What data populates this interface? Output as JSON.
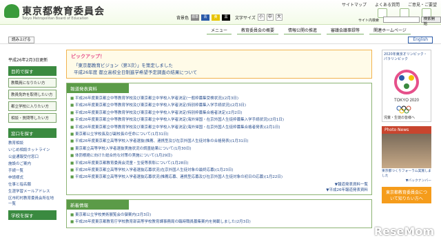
{
  "header": {
    "title": "東京都教育委員会",
    "subtitle": "Tokyo Metropolitan Board of Education",
    "links": [
      "サイトマップ",
      "よくある質問",
      "ご意見・ご要望"
    ],
    "bg_label": "背景色",
    "bg_options": [
      "標準",
      "青",
      "黄",
      "黒"
    ],
    "font_label": "文字サイズ",
    "font_options": [
      "小",
      "中",
      "大"
    ],
    "search_label": "サイト内検索",
    "search_button": "検索開始"
  },
  "nav": [
    "メニュー",
    "教育委員会の概要",
    "情報公開の推進",
    "審議会議事録等",
    "関連ホームページ"
  ],
  "subbar": {
    "read_button": "読み上げる",
    "english": "English"
  },
  "left": {
    "date": "平成26年2月3日更新",
    "purpose_title": "目的で探す",
    "purpose_items": [
      "教職員になりたい方",
      "教員免許を取得したい方",
      "都立学校に入りたい方",
      "相談・質問等したい方"
    ],
    "window_title": "窓口を探す",
    "window_items": [
      "教育相談",
      "いじめ相談ホットライン",
      "公益通報受付窓口",
      "施設のご案内",
      "手続一覧",
      "申請様式",
      "仕事と指名願",
      "生涯学習メールアドレス",
      "区市町村教育委員会所在地一覧"
    ],
    "school_title": "学校を探す"
  },
  "pickup": {
    "title": "ピックアップ！",
    "items": [
      "「東京都教育ビジョン（第3次）」を策定しました",
      "平成26年度 都立高校全日制進学希望予定調査の結果について"
    ]
  },
  "press": {
    "title": "報道発表資料",
    "items": [
      "平成26年度東京都立中等教育学校及び東京都立中学校入学者決定(一般枠募集受検状況)(2月3日)",
      "平成26年度東京都立中等教育学校及び東京都立中学校入学者決定(特別枠募集入学手続状況)(2月3日)",
      "平成26年度東京都立中等教育学校及び東京都立中学校入学者決定(特別枠募集合格者決定)(2月2日)",
      "平成26年度東京都立中等教育学校及び東京都立中学校入学者決定(海外帰国・在京外国人生徒枠募集入学手続状況)(2月1日)",
      "平成26年度東京都立中等教育学校及び東京都立中学校入学者決定(海外帰国・在京外国人生徒枠募集合格者発表)(2月1日)",
      "東京都公立学校長及び副校長の任命について(1月31日)",
      "平成26年度東京都立高等学校入学者選抜(推薦、連携型及び在京外国人生徒対象の合格発表)(1月31日)",
      "東京都立高等学校入学者選抜実施状況の調査結果について(1月30日)",
      "体罰根絶に向けた総合的な対策の実施について(1月29日)",
      "平成26年度東京都教育委員会児童・生徒等表彰について(1月28日)",
      "平成26年度東京都立高等学校入学者選抜応募状況(在京外国人生徒対象の最終応募)(1月23日)",
      "平成26年度東京都立高等学校入学者選抜応募状況(推薦応募、連携型応募及び在京外国人生徒対象の初日の応募)(1月22日)"
    ],
    "more_1": "▼報道発表資料一覧",
    "more_2": "▼平成26年報道発表資料"
  },
  "news": {
    "title": "新着情報",
    "items": [
      "東京都公立学校美術展覧会の御案内(2月3日)",
      "平成26年度東京都教育庁学校教育部高等学校教育課事務局の臨時職員募集案内を掲載しました(2月3日)"
    ]
  },
  "right": {
    "olympic_title": "2020年東京オリンピック・パラリンピック",
    "olympic_caption": "TOKYO 2020",
    "olympic_note": "児童・生徒の皆様へ",
    "photo_title": "Photo News",
    "photo_caption": "東京都つくりフォーラム実施しました",
    "more_link": "▼バックナンバー",
    "bubble": "東京都教育委員会について知りたい方へ"
  },
  "watermark": "ReseMom",
  "colors": {
    "green": "#3a8a40",
    "accent": "#e6508a",
    "orange": "#f59c1b",
    "red": "#c8452e"
  }
}
